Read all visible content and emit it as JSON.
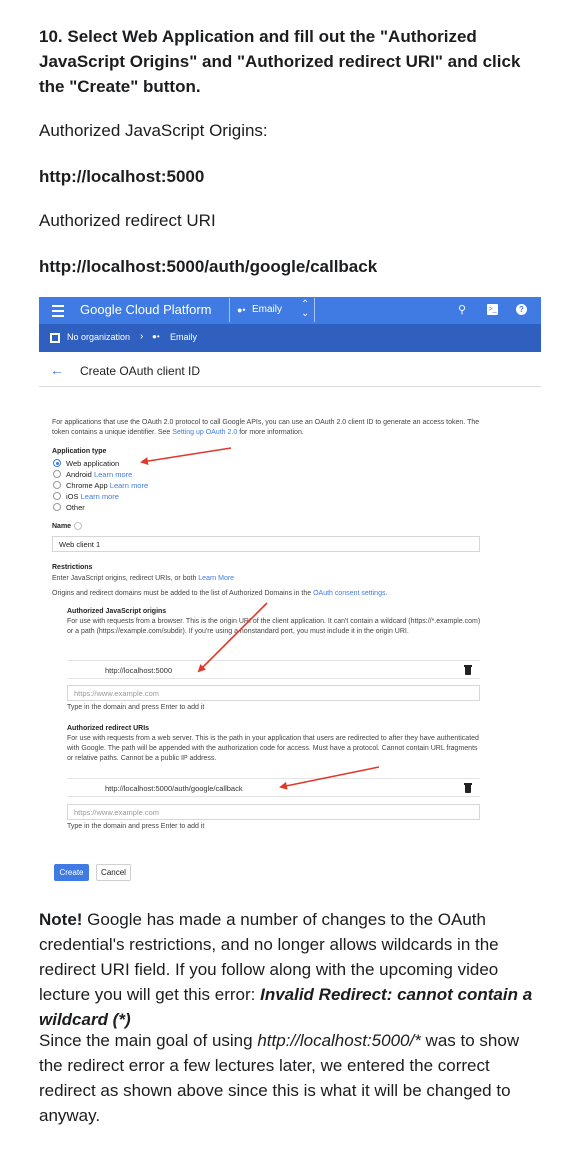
{
  "article": {
    "step_title": "10. Select Web Application and fill out the \"Authorized JavaScript Origins\" and \"Authorized redirect URI\" and click the \"Create\" button.",
    "origins_label": "Authorized JavaScript Origins:",
    "origins_value": "http://localhost:5000",
    "redirect_label": "Authorized redirect URI",
    "redirect_value": "http://localhost:5000/auth/google/callback",
    "note_bold": "Note!",
    "note_text": " Google has made a number of changes to the OAuth credential's restrictions, and no longer allows wildcards in the redirect URI field. If you follow along with the upcoming video lecture you will get this error: ",
    "note_error": "Invalid Redirect: cannot contain a wildcard (*)",
    "para2_start": "Since the main goal of using ",
    "para2_italic": "http://localhost:5000/*",
    "para2_end": " was to show the redirect error a few lectures later, we entered the correct redirect as shown above since this is what it will be changed to anyway."
  },
  "screenshot": {
    "topbar": {
      "brand": "Google Cloud Platform",
      "project": "Emaily",
      "icons": [
        "menu-icon",
        "search-icon",
        "terminal-icon",
        "help-icon"
      ]
    },
    "orgbar": {
      "org": "No organization",
      "project": "Emaily"
    },
    "page_title": "Create OAuth client ID",
    "intro": "For applications that use the OAuth 2.0 protocol to call Google APIs, you can use an OAuth 2.0 client ID to generate an access token. The token contains a unique identifier. See ",
    "intro_link": "Setting up OAuth 2.0",
    "intro_end": " for more information.",
    "app_type_label": "Application type",
    "app_types": [
      {
        "label": "Web application",
        "link": "",
        "selected": true
      },
      {
        "label": "Android",
        "link": "Learn more",
        "selected": false
      },
      {
        "label": "Chrome App",
        "link": "Learn more",
        "selected": false
      },
      {
        "label": "iOS",
        "link": "Learn more",
        "selected": false
      },
      {
        "label": "Other",
        "link": "",
        "selected": false
      }
    ],
    "name_label": "Name",
    "name_value": "Web client 1",
    "restrictions_label": "Restrictions",
    "restrictions_text": "Enter JavaScript origins, redirect URIs, or both ",
    "restrictions_link": "Learn More",
    "restrictions_text2": "Origins and redirect domains must be added to the list of Authorized Domains in the ",
    "restrictions_link2": "OAuth consent settings.",
    "js_origins_label": "Authorized JavaScript origins",
    "js_origins_help": "For use with requests from a browser. This is the origin URI of the client application. It can't contain a wildcard (https://*.example.com) or a path (https://example.com/subdir). If you're using a nonstandard port, you must include it in the origin URI.",
    "js_origin_value": "http://localhost:5000",
    "js_origin_placeholder": "https://www.example.com",
    "add_hint": "Type in the domain and press Enter to add it",
    "redirect_label": "Authorized redirect URIs",
    "redirect_help": "For use with requests from a web server. This is the path in your application that users are redirected to after they have authenticated with Google. The path will be appended with the authorization code for access. Must have a protocol. Cannot contain URL fragments or relative paths. Cannot be a public IP address.",
    "redirect_value": "http://localhost:5000/auth/google/callback",
    "redirect_placeholder": "https://www.example.com",
    "create_button": "Create",
    "cancel_button": "Cancel",
    "accent_color": "#3f7be2",
    "arrow_color": "#e0392b"
  }
}
